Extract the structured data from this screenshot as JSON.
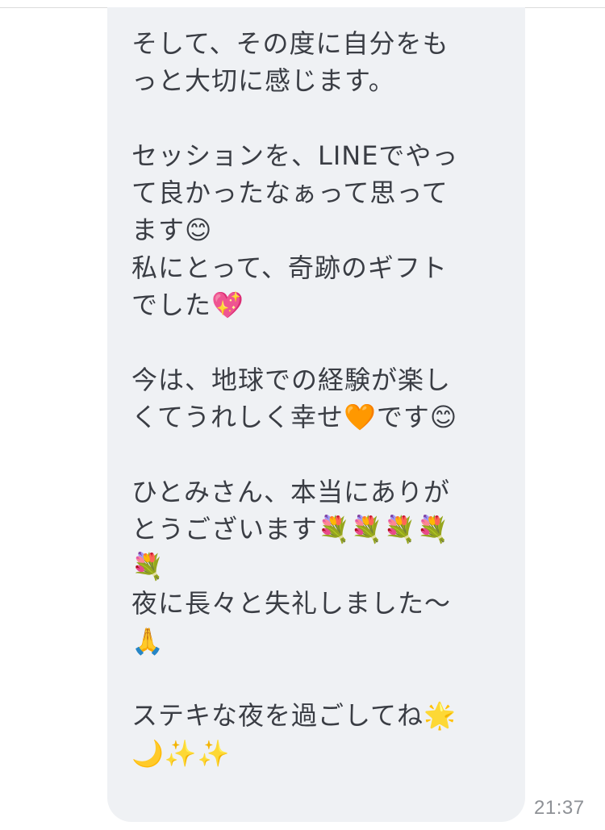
{
  "message": {
    "lines": [
      "そして、その度に自分をも",
      "っと大切に感じます。",
      "",
      "セッションを、LINEでやっ",
      "て良かったなぁって思って",
      "ます😊",
      "私にとって、奇跡のギフト",
      "でした💖",
      "",
      "今は、地球での経験が楽し",
      "くてうれしく幸せ🧡です😊",
      "",
      "ひとみさん、本当にありが",
      "とうございます💐💐💐💐",
      "💐",
      "夜に長々と失礼しました〜",
      "🙏",
      "",
      "ステキな夜を過ごしてね🌟",
      "🌙✨✨"
    ],
    "timestamp": "21:37"
  }
}
